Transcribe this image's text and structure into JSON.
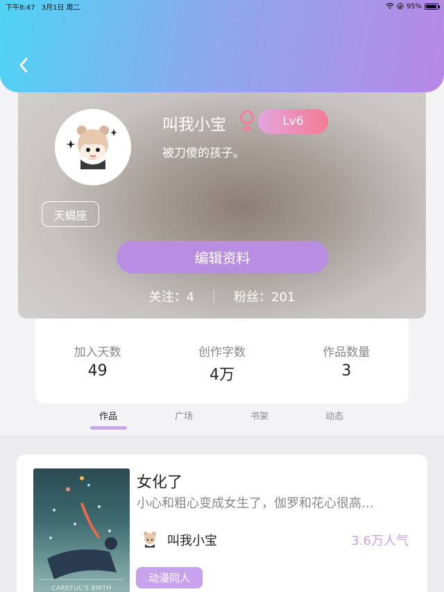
{
  "status_bar": {
    "time": "下午8:47",
    "date": "3月1日 周二",
    "battery": "95%"
  },
  "profile": {
    "username": "叫我小宝",
    "level": "Lv6",
    "signature": "被刀傻的孩子。",
    "zodiac": "天蝎座",
    "edit_label": "编辑资料",
    "following_label": "关注：",
    "following_count": "4",
    "followers_label": "粉丝：",
    "followers_count": "201"
  },
  "stats": [
    {
      "label": "加入天数",
      "value": "49"
    },
    {
      "label": "创作字数",
      "value": "4万"
    },
    {
      "label": "作品数量",
      "value": "3"
    }
  ],
  "tabs": [
    {
      "label": "作品",
      "active": true
    },
    {
      "label": "广场",
      "active": false
    },
    {
      "label": "书架",
      "active": false
    },
    {
      "label": "动态",
      "active": false
    }
  ],
  "work": {
    "title": "女化了",
    "description": "小心和粗心变成女生了，伽罗和花心很高…",
    "author": "叫我小宝",
    "popularity": "3.6万人气",
    "tag": "动漫同人",
    "cover_caption": "CAREFUL'S BIRTH"
  },
  "colors": {
    "header_gradient_start": "#4fd4f4",
    "header_gradient_end": "#b888e6",
    "accent_purple": "#b98ee2",
    "level_pink": "#f57a92",
    "popularity": "#c7a3e8"
  }
}
